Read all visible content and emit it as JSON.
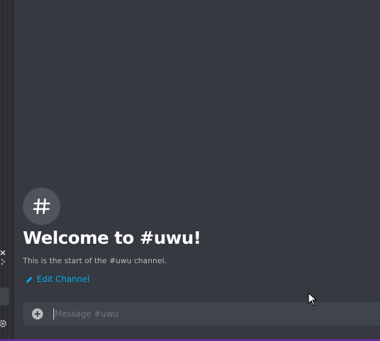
{
  "channel": {
    "hash_symbol": "#",
    "welcome_title": "Welcome to #uwu!",
    "welcome_subtitle": "This is the start of the #uwu channel.",
    "edit_label": "Edit Channel"
  },
  "composer": {
    "placeholder": "Message #uwu",
    "value": ""
  },
  "icons": {
    "hash": "hash-icon",
    "pencil": "pencil-icon",
    "attach": "plus-circle-icon",
    "close": "close-icon",
    "gear": "gear-icon",
    "cursor": "mouse-pointer"
  },
  "colors": {
    "background": "#36393f",
    "sidebar": "#2f3136",
    "input": "#40444b",
    "link": "#00aff4",
    "title": "#ffffff",
    "subtitle": "#b9bbbe",
    "taskbar": "#5c2d91"
  }
}
